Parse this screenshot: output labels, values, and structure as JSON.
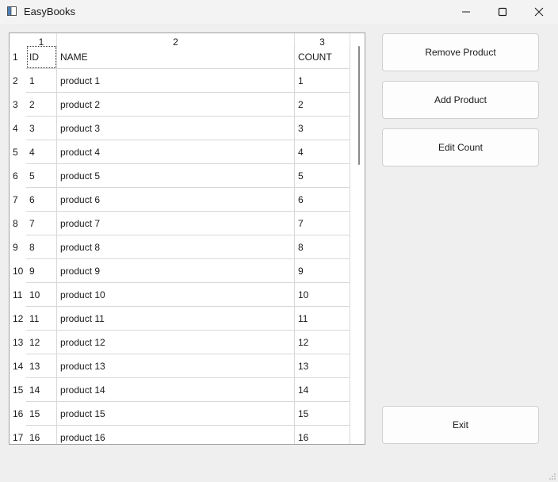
{
  "window": {
    "title": "EasyBooks"
  },
  "table": {
    "column_headers": [
      "1",
      "2",
      "3"
    ],
    "row_headers": [
      "1",
      "2",
      "3",
      "4",
      "5",
      "6",
      "7",
      "8",
      "9",
      "10",
      "11",
      "12",
      "13",
      "14",
      "15",
      "16",
      "17"
    ],
    "rows": [
      [
        "ID",
        "NAME",
        "COUNT"
      ],
      [
        "1",
        "product 1",
        "1"
      ],
      [
        "2",
        "product 2",
        "2"
      ],
      [
        "3",
        "product 3",
        "3"
      ],
      [
        "4",
        "product 4",
        "4"
      ],
      [
        "5",
        "product 5",
        "5"
      ],
      [
        "6",
        "product 6",
        "6"
      ],
      [
        "7",
        "product 7",
        "7"
      ],
      [
        "8",
        "product 8",
        "8"
      ],
      [
        "9",
        "product 9",
        "9"
      ],
      [
        "10",
        "product 10",
        "10"
      ],
      [
        "11",
        "product 11",
        "11"
      ],
      [
        "12",
        "product 12",
        "12"
      ],
      [
        "13",
        "product 13",
        "13"
      ],
      [
        "14",
        "product 14",
        "14"
      ],
      [
        "15",
        "product 15",
        "15"
      ],
      [
        "16",
        "product 16",
        "16"
      ]
    ]
  },
  "buttons": {
    "remove": "Remove Product",
    "add": "Add Product",
    "edit": "Edit Count",
    "exit": "Exit"
  }
}
